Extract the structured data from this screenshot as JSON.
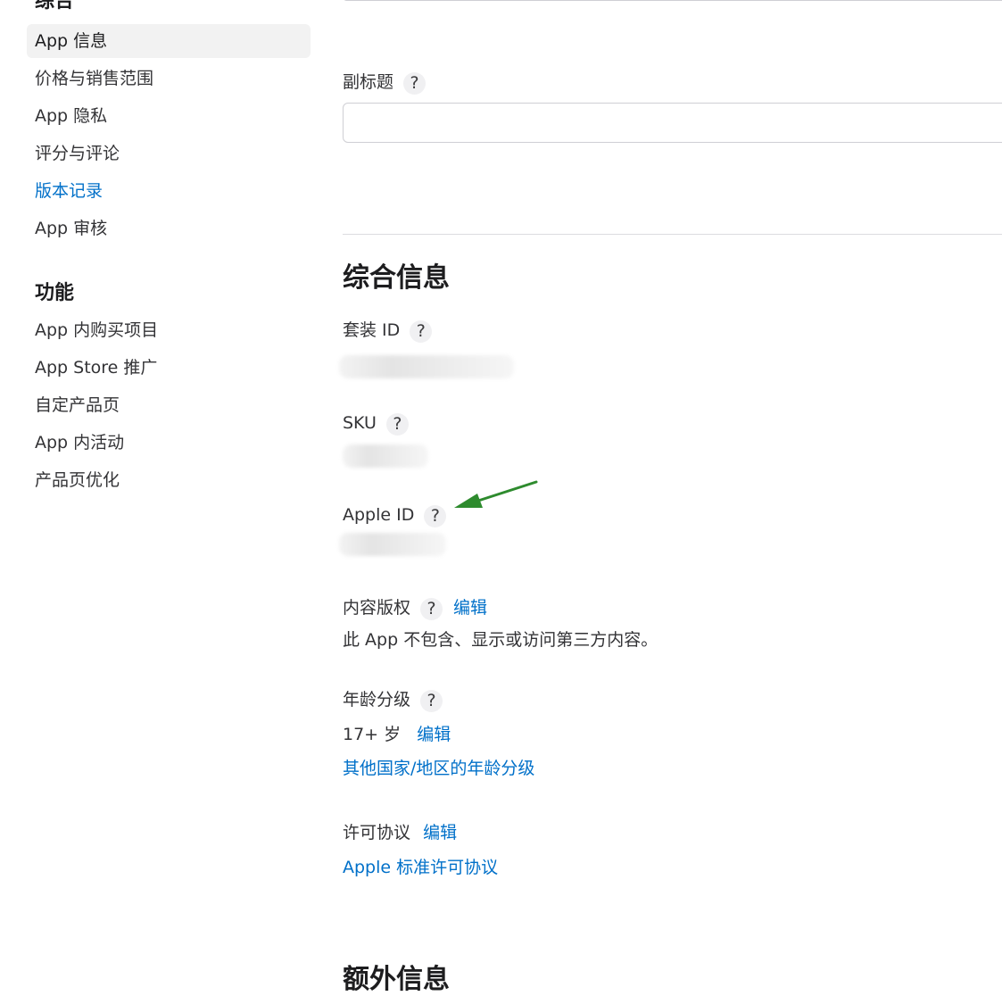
{
  "sidebar": {
    "general_heading": "综合",
    "general_items": [
      {
        "label": "App 信息",
        "active": true
      },
      {
        "label": "价格与销售范围"
      },
      {
        "label": "App 隐私"
      },
      {
        "label": "评分与评论"
      },
      {
        "label": "版本记录",
        "link": true
      },
      {
        "label": "App 审核"
      }
    ],
    "features_heading": "功能",
    "feature_items": [
      {
        "label": "App 内购买项目"
      },
      {
        "label": "App Store 推广"
      },
      {
        "label": "自定产品页"
      },
      {
        "label": "App 内活动"
      },
      {
        "label": "产品页优化"
      }
    ]
  },
  "main": {
    "subtitle": {
      "label": "副标题",
      "help": "?",
      "value": ""
    },
    "general_info": {
      "title": "综合信息",
      "bundle_id": {
        "label": "套装 ID",
        "help": "?"
      },
      "sku": {
        "label": "SKU",
        "help": "?"
      },
      "apple_id": {
        "label": "Apple ID",
        "help": "?"
      },
      "content_rights": {
        "label": "内容版权",
        "help": "?",
        "edit": "编辑",
        "value": "此 App 不包含、显示或访问第三方内容。"
      },
      "age_rating": {
        "label": "年龄分级",
        "help": "?",
        "value": "17+ 岁",
        "edit": "编辑",
        "other_link": "其他国家/地区的年龄分级"
      },
      "license": {
        "label": "许可协议",
        "edit": "编辑",
        "link": "Apple 标准许可协议"
      }
    },
    "additional_info": {
      "title": "额外信息"
    }
  },
  "colors": {
    "link": "#0070c9",
    "text": "#333336",
    "heading": "#1d1d1f",
    "active_bg": "#f2f2f2",
    "annotation_arrow": "#2e8b2e"
  },
  "icons": {
    "help": "question-mark-circle-icon",
    "annotation": "green-arrow-icon"
  }
}
